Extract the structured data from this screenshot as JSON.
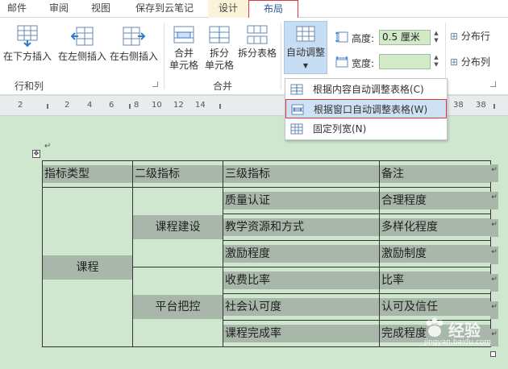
{
  "tabs": [
    {
      "label": "邮件"
    },
    {
      "label": "审阅"
    },
    {
      "label": "视图"
    },
    {
      "label": "保存到云笔记"
    },
    {
      "label": "设计"
    },
    {
      "label": "布局"
    }
  ],
  "ribbon": {
    "insert_below": "在下方插入",
    "insert_left": "在左侧插入",
    "insert_right": "在右侧插入",
    "group_rows_cols": "行和列",
    "merge_cells_1": "合并",
    "merge_cells_2": "单元格",
    "split_cells_1": "拆分",
    "split_cells_2": "单元格",
    "split_table": "拆分表格",
    "group_merge": "合并",
    "autofit": "自动调整",
    "height_label": "高度:",
    "height_value": "0.5 厘米",
    "width_label": "宽度:",
    "width_value": "",
    "distribute_rows": "分布行",
    "distribute_cols": "分布列"
  },
  "ruler": {
    "numbers": [
      "2",
      "2",
      "4",
      "6",
      "8",
      "10",
      "12",
      "14",
      "38",
      "38"
    ]
  },
  "dropdown": {
    "items": [
      {
        "label": "根据内容自动调整表格(C)"
      },
      {
        "label": "根据窗口自动调整表格(W)"
      },
      {
        "label": "固定列宽(N)"
      }
    ]
  },
  "table": {
    "headers": [
      "指标类型",
      "二级指标",
      "三级指标",
      "备注"
    ],
    "category": "课程",
    "sub1": "课程建设",
    "sub2": "平台把控",
    "rows": [
      {
        "level3": "质量认证",
        "note": "合理程度"
      },
      {
        "level3": "教学资源和方式",
        "note": "多样化程度"
      },
      {
        "level3": "激励程度",
        "note": "激励制度"
      },
      {
        "level3": "收费比率",
        "note": "比率"
      },
      {
        "level3": "社会认可度",
        "note": "认可及信任"
      },
      {
        "level3": "课程完成率",
        "note": "完成程度"
      }
    ]
  },
  "watermark": {
    "text": "经验",
    "url_text": "jingyan.baidu.com"
  },
  "colors": {
    "accent_blue": "#2b5797",
    "highlight_red": "#e0383e",
    "doc_bg": "#cfe6cf"
  }
}
